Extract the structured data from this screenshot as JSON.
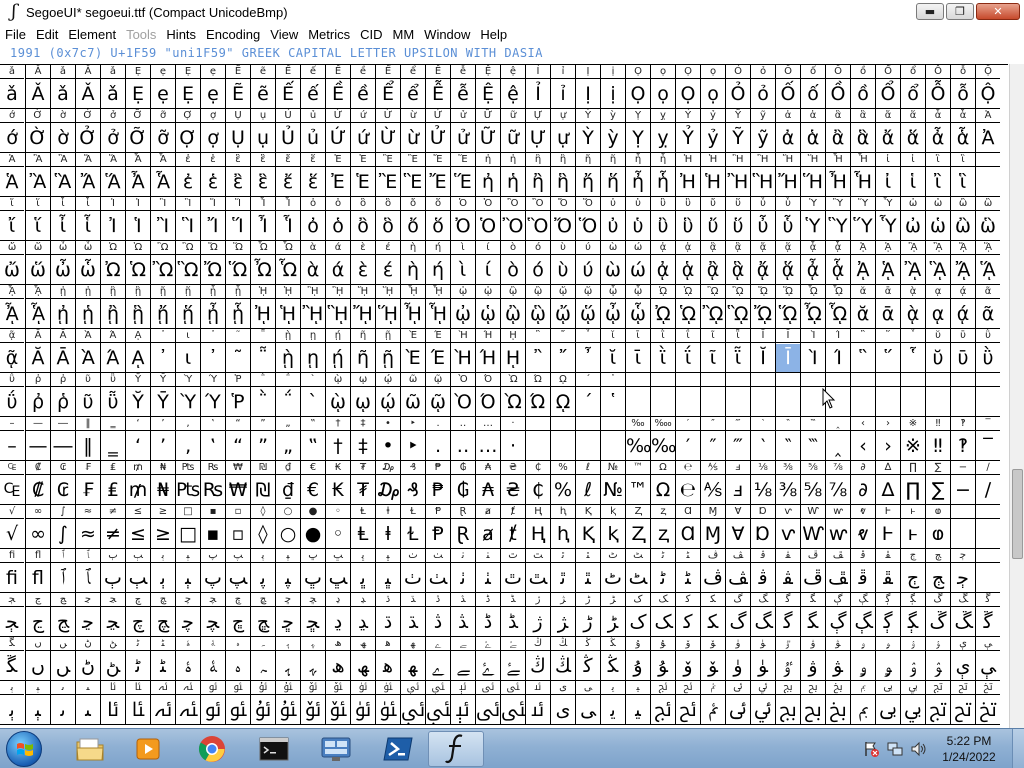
{
  "window": {
    "title": "SegoeUI* segoeui.ttf (Compact UnicodeBmp)",
    "controls": {
      "minimize": "▬",
      "maximize": "❐",
      "close": "✕"
    }
  },
  "menu": [
    {
      "label": "File",
      "enabled": true
    },
    {
      "label": "Edit",
      "enabled": true
    },
    {
      "label": "Element",
      "enabled": true
    },
    {
      "label": "Tools",
      "enabled": false
    },
    {
      "label": "Hints",
      "enabled": true
    },
    {
      "label": "Encoding",
      "enabled": true
    },
    {
      "label": "View",
      "enabled": true
    },
    {
      "label": "Metrics",
      "enabled": true
    },
    {
      "label": "CID",
      "enabled": true
    },
    {
      "label": "MM",
      "enabled": true
    },
    {
      "label": "Window",
      "enabled": true
    },
    {
      "label": "Help",
      "enabled": true
    }
  ],
  "info_line": "1991 (0x7c7) U+1F59 \"uni1F59\" GREEK CAPITAL LETTER UPSILON WITH DASIA",
  "selected_cell": {
    "row": 6,
    "col": 31
  },
  "grid_rows": [
    [
      "ǎǍǎǍǎẸẹẸẹẼẽẾếỀềỂểỄễỆệỈỉỊịỌọỌọỎỏỐốỒồỔổỖỗỘộỚ",
      "ǎǍǎǍǎẸẹẸẹẼẽẾếỀềỂểỄễỆệỈỉỊịỌọỌọỎỏỐốỒồỔổỖỗỘộỚ"
    ],
    [
      "ớỜờỞởỠỡỢợỤụỦủỨứỪừỬửỮữỰựỲỳỴỵỶỷỸỹἀἁἂἃἄἅἆἇἈ",
      "ớỜờỞởỠỡỢợỤụỦủỨứỪừỬửỮữỰựỲỳỴỵỶỷỸỹἀἁἂἃἄἅἆἇἈ"
    ],
    [
      "ἉἊἋἌἍἎἏἐἑἒἓἔἕἘἙἚἛἜἝἠἡἢἣἤἥἦἧἨἩἪἫἬἭἮἯἰἱἲἳ",
      "ἉἊἋἌἍἎἏἐἑἒἓἔἕἘἙἚἛἜἝἠἡἢἣἤἥἦἧἨἩἪἫἬἭἮἯἰἱἲἳ"
    ],
    [
      "ἴἵἶἷἸἹἺἻἼἽἾἿὀὁὂὃὄὅὈὉὊὋὌὍὐὑὒὓὔὕὖὗὙὛὝὟὠὡὢὣ",
      "ἴἵἶἷἸἹἺἻἼἽἾἿὀὁὂὃὄὅὈὉὊὋὌὍὐὑὒὓὔὕὖὗὙὛὝὟὠὡὢὣ"
    ],
    [
      "ὤὥὦὧὨὩὪὫὬὭὮὯὰάὲέὴήὶίὸόὺύὼώᾀᾁᾂᾃᾄᾅᾆᾇᾈᾉᾊᾋᾌᾍ",
      "ὤὥὦὧὨὩὪὫὬὭὮὯὰάὲέὴήὶίὸόὺύὼώᾀᾁᾂᾃᾄᾅᾆᾇᾈᾉᾊᾋᾌᾍ"
    ],
    [
      "ᾎᾏᾐᾑᾒᾓᾔᾕᾖᾗᾘᾙᾚᾛᾜᾝᾞᾟᾠᾡᾢᾣᾤᾥᾦᾧᾨᾩᾪᾫᾬᾭᾮᾯᾰᾱᾲᾳᾴᾶ",
      "ᾎᾏᾐᾑᾒᾓᾔᾕᾖᾗᾘᾙᾚᾛᾜᾝᾞᾟᾠᾡᾢᾣᾤᾥᾦᾧᾨᾩᾪᾫᾬᾭᾮᾯᾰᾱᾲᾳᾴᾶ"
    ],
    [
      "ᾷᾸᾹᾺΆᾼ᾽ι᾿῀῁ῂῃῄῆῇῈΈῊΉῌ῍῎῏ῐῑῒΐῖῗῘῙῚΊ῝῞῟ῠῡῢ",
      "ᾷᾸᾹᾺΆᾼ᾽ι᾿῀῁ῂῃῄῆῇῈΈῊΉῌ῍῎῏ῐῑῒΐῖῗῘῙῚΊ῝῞῟ῠῡῢ"
    ],
    [
      "ΰῤῥῦῧῨῩῪΎῬ῭΅`ῲῳῴῶῷῸΌῺΏῼ´῾              ",
      "ΰῤῥῦῧῨῩῪΎῬ῭΅`ῲῳῴῶῷῸΌῺΏῼ´῾              "
    ],
    [
      "–—―‖‗‘’‚‛“”„‟†‡•‣․‥…‧    ‰‱′″‴‵‶‷‸‹›※‼‽‾‿⁀⁁⁂",
      "–—―‖‗‘’‚‛“”„‟†‡•‣․‥…‧    ‰‱′″‴‵‶‷‸‹›※‼‽‾‿⁀⁁⁂"
    ],
    [
      "₠₡₢₣₤₥₦₧₨₩₪₫€₭₮₯₰₱₲₳₴₵%ℓ№™Ω℮⅍ⅎ⅛⅜⅝⅞∂∆∏∑−∕∙",
      "₠₡₢₣₤₥₦₧₨₩₪₫€₭₮₯₰₱₲₳₴₵%ℓ№™Ω℮⅍ⅎ⅛⅜⅝⅞∂∆∏∑−∕∙"
    ],
    [
      "√∞∫≈≠≤≥□▪▫◊○●◦ⱠⱡⱢⱣⱤⱥⱦⱧⱨⱩⱪⱫⱬⱭⱮⱯⱰⱱⱲⱳⱴⱵⱶⱷ",
      "√∞∫≈≠≤≥□▪▫◊○●◦ⱠⱡⱢⱣⱤⱥⱦⱧⱨⱩⱪⱫⱬⱭⱮⱯⱰⱱⱲⱳⱴⱵⱶⱷ"
    ],
    [
      "ﬁﬂﭐﭑﭒﭓﭔﭕﭖﭗﭘﭙﭚﭛﭜﭝﭞﭟﭠﭡﭢﭣﭤﭥﭦﭧﭨﭩﭪﭫﭬﭭﭮﭯﭰﭱﭲﭳﭴ",
      "ﬁﬂﭐﭑﭒﭓﭔﭕﭖﭗﭘﭙﭚﭛﭜﭝﭞﭟﭠﭡﭢﭣﭤﭥﭦﭧﭨﭩﭪﭫﭬﭭﭮﭯﭰﭱﭲﭳﭴ"
    ],
    [
      "ﭵﭶﭷﭸﭹﭺﭻﭼﭽﭾﭿﮀﮁﮂﮃﮄﮅﮆﮇﮈﮉﮊﮋﮌﮍﮎﮏﮐﮑﮒﮓﮔﮕﮖﮗﮘﮙﮚﮛﮜ",
      "ﭵﭶﭷﭸﭹﭺﭻﭼﭽﭾﭿﮀﮁﮂﮃﮄﮅﮆﮇﮈﮉﮊﮋﮌﮍﮎﮏﮐﮑﮒﮓﮔﮕﮖﮗﮘﮙﮚﮛﮜ"
    ],
    [
      "ﮝﮞﮟﮠﮡﮢﮣﮤﮥﮦﮧﮨﮩﮪﮫﮬﮭﮮﮯﮰﮱﯓﯔﯕﯖﯗﯘﯙﯚﯛﯜﯝﯞﯟﯠﯡﯢﯣﯤﯥ",
      "ﮝﮞﮟﮠﮡﮢﮣﮤﮥﮦﮧﮨﮩﮪﮫﮬﮭﮮﮯﮰﮱﯓﯔﯕﯖﯗﯘﯙﯚﯛﯜﯝﯞﯟﯠﯡﯢﯣﯤﯥ"
    ],
    [
      "ﯦﯧﯨﯩﯪﯫﯬﯭﯮﯯﯰﯱﯲﯳﯴﯵﯶﯷﯸﯹﯺﯻﯼﯽﯾﯿﰀﰁﰂﰃﰄﰅﰆﰇﰈﰉﰊﰋﰌﰍ",
      "ﯦﯧﯨﯩﯪﯫﯬﯭﯮﯯﯰﯱﯲﯳﯴﯵﯶﯷﯸﯹﯺﯻﯼﯽﯾﯿﰀﰁﰂﰃﰄﰅﰆﰇﰈﰉﰊﰋﰌﰍ"
    ]
  ],
  "taskbar": {
    "apps": [
      {
        "name": "Windows Explorer"
      },
      {
        "name": "Windows Media Player"
      },
      {
        "name": "Google Chrome"
      },
      {
        "name": "Command Prompt"
      },
      {
        "name": "Remote Desktop"
      },
      {
        "name": "Windows PowerShell"
      },
      {
        "name": "FontForge",
        "active": true
      }
    ],
    "clock_time": "5:22 PM",
    "clock_date": "1/24/2022"
  }
}
